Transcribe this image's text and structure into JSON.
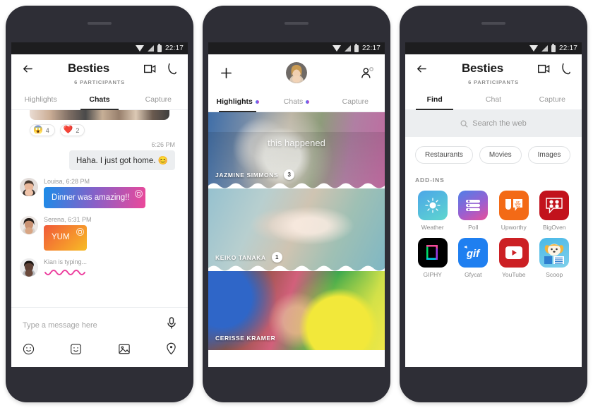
{
  "status_bar": {
    "time": "22:17",
    "icons": [
      "wifi-icon",
      "signal-icon",
      "battery-icon"
    ]
  },
  "phone1": {
    "header": {
      "back_icon": "back-arrow-icon",
      "title": "Besties",
      "subtitle": "6 PARTICIPANTS",
      "video_icon": "video-call-icon",
      "call_icon": "phone-call-icon"
    },
    "tabs": [
      {
        "label": "Highlights",
        "active": false
      },
      {
        "label": "Chats",
        "active": true
      },
      {
        "label": "Capture",
        "active": false
      }
    ],
    "reactions": [
      {
        "emoji": "😱",
        "count": "4"
      },
      {
        "emoji": "❤️",
        "count": "2"
      }
    ],
    "messages": [
      {
        "timestamp": "6:26 PM",
        "text": "Haha. I just got home. 😊",
        "outgoing": true
      },
      {
        "sender": "Louisa",
        "time": "6:28 PM",
        "meta": "Louisa, 6:28 PM",
        "text": "Dinner was amazing!!",
        "outgoing": false
      },
      {
        "sender": "Serena",
        "time": "6:31 PM",
        "meta": "Serena, 6:31 PM",
        "text": "YUM",
        "outgoing": false
      }
    ],
    "typing": {
      "text": "Kian is typing..."
    },
    "composer": {
      "placeholder": "Type a message here",
      "mic_icon": "microphone-icon",
      "tools": [
        "emoji-icon",
        "sticker-icon",
        "photo-icon",
        "location-icon"
      ]
    }
  },
  "phone2": {
    "header": {
      "add_icon": "plus-icon",
      "avatar": "user-avatar",
      "add_contact_icon": "add-person-icon"
    },
    "tabs": [
      {
        "label": "Highlights",
        "active": true,
        "dot": true
      },
      {
        "label": "Chats",
        "active": false,
        "dot": true
      },
      {
        "label": "Capture",
        "active": false,
        "dot": false
      }
    ],
    "overlay_caption": "this happened",
    "highlights": [
      {
        "name": "JAZMINE SIMMONS",
        "count": "3"
      },
      {
        "name": "KEIKO TANAKA",
        "count": "1"
      },
      {
        "name": "CERISSE KRAMER",
        "count": ""
      }
    ]
  },
  "phone3": {
    "header": {
      "back_icon": "back-arrow-icon",
      "title": "Besties",
      "subtitle": "6 PARTICIPANTS",
      "video_icon": "video-call-icon",
      "call_icon": "phone-call-icon"
    },
    "tabs": [
      {
        "label": "Find",
        "active": true
      },
      {
        "label": "Chat",
        "active": false
      },
      {
        "label": "Capture",
        "active": false
      }
    ],
    "search": {
      "placeholder": "Search the web",
      "icon": "search-icon"
    },
    "chips": [
      "Restaurants",
      "Movies",
      "Images"
    ],
    "addins_label": "ADD-INS",
    "addins": [
      {
        "label": "Weather",
        "icon": "weather-sun-icon",
        "color": "#4ba6e8"
      },
      {
        "label": "Poll",
        "icon": "poll-bars-icon",
        "color": "#9b5fd0"
      },
      {
        "label": "Upworthy",
        "icon": "upworthy-icon",
        "color": "#f36a16"
      },
      {
        "label": "BigOven",
        "icon": "bigoven-icon",
        "color": "#c2121c"
      },
      {
        "label": "GIPHY",
        "icon": "giphy-icon",
        "color": "#000000"
      },
      {
        "label": "Gfycat",
        "icon": "gfycat-gif-icon",
        "color": "#1f7ff0"
      },
      {
        "label": "YouTube",
        "icon": "youtube-play-icon",
        "color": "#cc2024"
      },
      {
        "label": "Scoop",
        "icon": "scoop-dog-icon",
        "color": "#49b8e8"
      }
    ]
  }
}
